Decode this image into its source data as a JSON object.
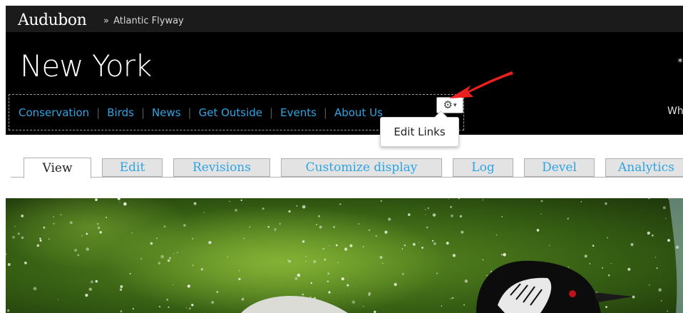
{
  "header": {
    "brand": "Audubon",
    "separator": "»",
    "breadcrumb": "Atlantic Flyway",
    "region_title": "New York",
    "right_edge_text": "Wh"
  },
  "menu": {
    "items": [
      {
        "label": "Conservation"
      },
      {
        "label": "Birds"
      },
      {
        "label": "News"
      },
      {
        "label": "Get Outside"
      },
      {
        "label": "Events"
      },
      {
        "label": "About Us"
      }
    ],
    "divider": "|"
  },
  "contextual": {
    "gear_icon": "gear-icon",
    "tooltip": "Edit Links"
  },
  "tabs": [
    {
      "label": "View",
      "active": true
    },
    {
      "label": "Edit"
    },
    {
      "label": "Revisions"
    },
    {
      "label": "Customize display"
    },
    {
      "label": "Log"
    },
    {
      "label": "Devel"
    },
    {
      "label": "Analytics"
    }
  ],
  "colors": {
    "link": "#2fa4e2",
    "annotation_arrow": "#e8201e",
    "header_bg": "#000000"
  }
}
